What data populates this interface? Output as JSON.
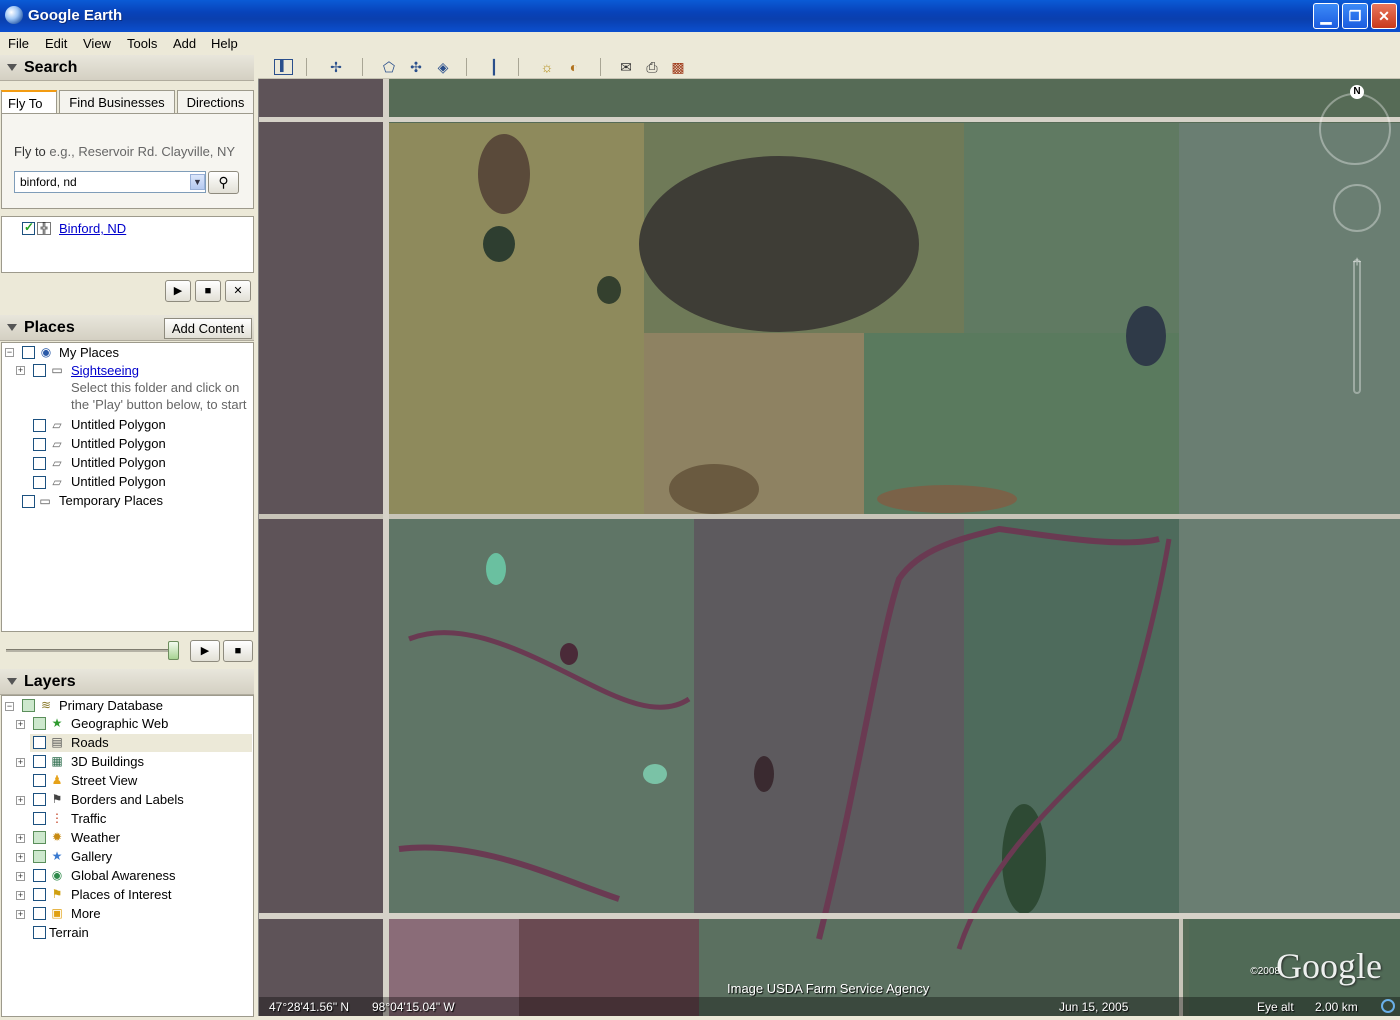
{
  "window": {
    "title": "Google Earth"
  },
  "menu": [
    "File",
    "Edit",
    "View",
    "Tools",
    "Add",
    "Help"
  ],
  "search": {
    "header": "Search",
    "tabs": [
      "Fly To",
      "Find Businesses",
      "Directions"
    ],
    "fly_to_label": "Fly to",
    "fly_to_hint": "e.g., Reservoir Rd. Clayville, NY",
    "input_value": "binford, nd",
    "result": "Binford, ND"
  },
  "places": {
    "header": "Places",
    "add_content": "Add Content",
    "items": {
      "my_places": "My Places",
      "sightseeing": "Sightseeing",
      "sightseeing_note_1": "Select this folder and click on",
      "sightseeing_note_2": "the 'Play' button below, to start",
      "poly1": "Untitled Polygon",
      "poly2": "Untitled Polygon",
      "poly3": "Untitled Polygon",
      "poly4": "Untitled Polygon",
      "temporary": "Temporary Places"
    },
    "tour_slider_value": 0.97
  },
  "layers": {
    "header": "Layers",
    "items": {
      "primary": "Primary Database",
      "geoweb": "Geographic Web",
      "roads": "Roads",
      "buildings": "3D Buildings",
      "streetview": "Street View",
      "borders": "Borders and Labels",
      "traffic": "Traffic",
      "weather": "Weather",
      "gallery": "Gallery",
      "awareness": "Global Awareness",
      "poi": "Places of Interest",
      "more": "More",
      "terrain": "Terrain"
    }
  },
  "map": {
    "imagery_credit": "Image USDA Farm Service Agency",
    "copyright": "©2008",
    "logo": "Google",
    "lat": "47°28'41.56\" N",
    "lon": "98°04'15.04\" W",
    "date": "Jun 15, 2005",
    "eye_alt_label": "Eye alt",
    "eye_alt_value": "2.00 km",
    "compass_north": "N"
  }
}
